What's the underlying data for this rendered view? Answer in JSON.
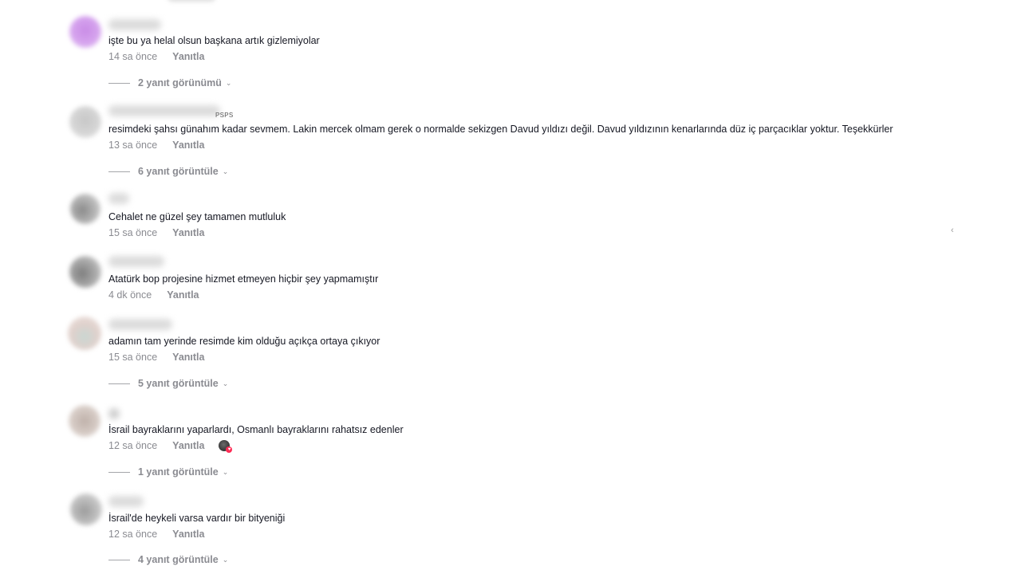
{
  "comments": [
    {
      "text": "işte bu ya helal olsun başkana artık gizlemiyolar",
      "time": "14 sa önce",
      "reply_label": "Yanıtla",
      "replies_label": "2 yanıt görünümü",
      "avatar_color": "#c98ce6"
    },
    {
      "username_suffix": "PSPS",
      "text": "resimdeki şahsı günahım kadar sevmem. Lakin mercek olmam gerek o normalde sekizgen Davud yıldızı değil. Davud yıldızının kenarlarında düz iç parçacıklar yoktur. Teşekkürler",
      "time": "13 sa önce",
      "reply_label": "Yanıtla",
      "replies_label": "6 yanıt görüntüle",
      "avatar_color": "#cfcfcf"
    },
    {
      "text": "Cehalet ne güzel şey tamamen mutluluk",
      "time": "15 sa önce",
      "reply_label": "Yanıtla",
      "avatar_color": "#9a9a9a"
    },
    {
      "text": "Atatürk bop projesine hizmet etmeyen hiçbir şey yapmamıştır",
      "time": "4 dk önce",
      "reply_label": "Yanıtla",
      "avatar_color": "#8e8e8e"
    },
    {
      "text": "adamın tam yerinde resimde kim olduğu açıkça ortaya çıkıyor",
      "time": "15 sa önce",
      "reply_label": "Yanıtla",
      "replies_label": "5 yanıt görüntüle",
      "avatar_color": "#d8c9c4"
    },
    {
      "text": "İsrail bayraklarını yaparlardı, Osmanlı bayraklarını rahatsız edenler",
      "time": "12 sa önce",
      "reply_label": "Yanıtla",
      "replies_label": "1 yanıt görüntüle",
      "avatar_color": "#c9bdb6"
    },
    {
      "text": "İsrail'de heykeli varsa vardır bir bityeniği",
      "time": "12 sa önce",
      "reply_label": "Yanıtla",
      "replies_label": "4 yanıt görüntüle",
      "avatar_color": "#a9a9a9"
    }
  ],
  "icons": {
    "chevron": "chevron-down-icon",
    "creator_like": "creator-liked-avatar-icon"
  },
  "side_mark": "‹"
}
